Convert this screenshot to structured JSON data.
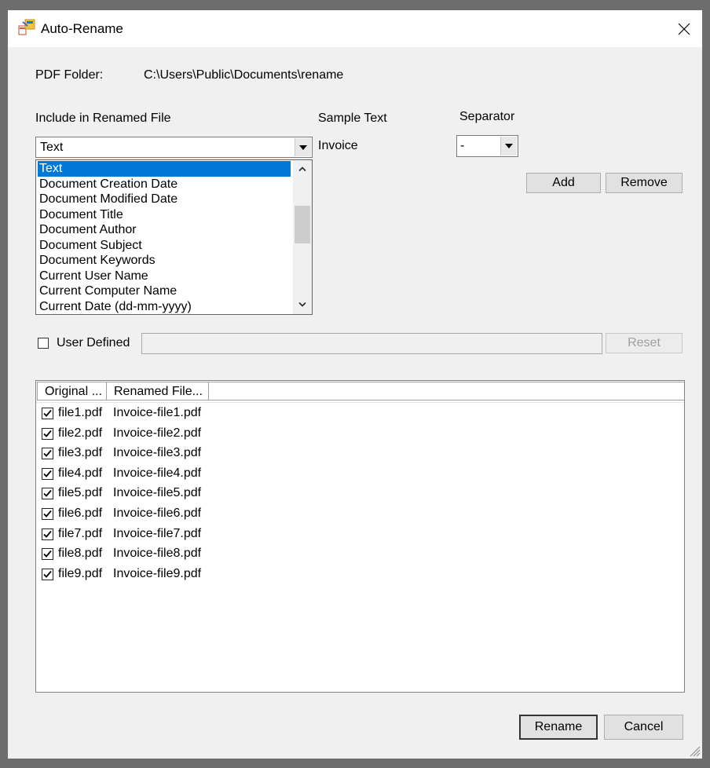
{
  "window": {
    "title": "Auto-Rename"
  },
  "pdf_folder": {
    "label": "PDF Folder:",
    "path": "C:\\Users\\Public\\Documents\\rename"
  },
  "include": {
    "label": "Include in Renamed File",
    "selected": "Text",
    "options": [
      "Text",
      "Document Creation Date",
      "Document Modified Date",
      "Document Title",
      "Document Author",
      "Document Subject",
      "Document Keywords",
      "Current User Name",
      "Current Computer Name",
      "Current Date (dd-mm-yyyy)"
    ]
  },
  "sample": {
    "label": "Sample Text",
    "value": "Invoice"
  },
  "separator": {
    "label": "Separator",
    "value": "-"
  },
  "buttons": {
    "add": "Add",
    "remove": "Remove",
    "reset": "Reset",
    "rename": "Rename",
    "cancel": "Cancel"
  },
  "user_defined": {
    "label": "User Defined",
    "checked": false,
    "value": ""
  },
  "file_list": {
    "columns": [
      "Original ...",
      "Renamed File..."
    ],
    "rows": [
      {
        "original": "file1.pdf",
        "renamed": "Invoice-file1.pdf",
        "checked": true
      },
      {
        "original": "file2.pdf",
        "renamed": "Invoice-file2.pdf",
        "checked": true
      },
      {
        "original": "file3.pdf",
        "renamed": "Invoice-file3.pdf",
        "checked": true
      },
      {
        "original": "file4.pdf",
        "renamed": "Invoice-file4.pdf",
        "checked": true
      },
      {
        "original": "file5.pdf",
        "renamed": "Invoice-file5.pdf",
        "checked": true
      },
      {
        "original": "file6.pdf",
        "renamed": "Invoice-file6.pdf",
        "checked": true
      },
      {
        "original": "file7.pdf",
        "renamed": "Invoice-file7.pdf",
        "checked": true
      },
      {
        "original": "file8.pdf",
        "renamed": "Invoice-file8.pdf",
        "checked": true
      },
      {
        "original": "file9.pdf",
        "renamed": "Invoice-file9.pdf",
        "checked": true
      }
    ]
  },
  "colors": {
    "selection": "#0078d7",
    "window_bg": "#f0f0f0"
  }
}
